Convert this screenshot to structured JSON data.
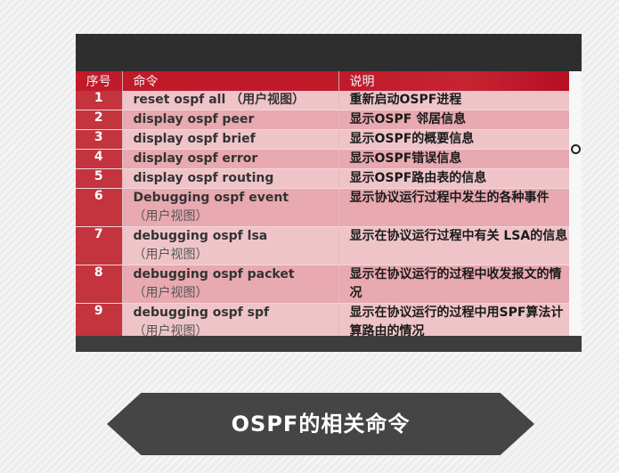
{
  "table": {
    "headers": {
      "num": "序号",
      "cmd": "命令",
      "desc": "说明"
    },
    "rows": [
      {
        "num": "1",
        "cmd": "reset  ospf all （用户视图）",
        "note": "",
        "desc": "重新启动OSPF进程"
      },
      {
        "num": "2",
        "cmd": "display  ospf  peer",
        "note": "",
        "desc": "显示OSPF 邻居信息"
      },
      {
        "num": "3",
        "cmd": "display  ospf  brief",
        "note": "",
        "desc": "显示OSPF的概要信息"
      },
      {
        "num": "4",
        "cmd": "display  ospf  error",
        "note": "",
        "desc": "显示OSPF错误信息"
      },
      {
        "num": "5",
        "cmd": "display  ospf  routing",
        "note": "",
        "desc": "显示OSPF路由表的信息"
      },
      {
        "num": "6",
        "cmd": "Debugging  ospf    event",
        "note": "（用户视图）",
        "desc": "显示协议运行过程中发生的各种事件"
      },
      {
        "num": "7",
        "cmd": "debugging  ospf  lsa",
        "note": "（用户视图）",
        "desc": "显示在协议运行过程中有关 LSA的信息"
      },
      {
        "num": "8",
        "cmd": "debugging  ospf  packet",
        "note": "（用户视图）",
        "desc": "显示在协议运行的过程中收发报文的情况"
      },
      {
        "num": "9",
        "cmd": "debugging  ospf  spf",
        "note": "（用户视图）",
        "desc": "显示在协议运行的过程中用SPF算法计算路由的情况"
      }
    ]
  },
  "caption": "OSPF的相关命令",
  "colors": {
    "header_red": "#c01a2b",
    "row_light": "#efc4c9",
    "row_dark": "#e8a9b1",
    "caption_bg": "#454545"
  }
}
